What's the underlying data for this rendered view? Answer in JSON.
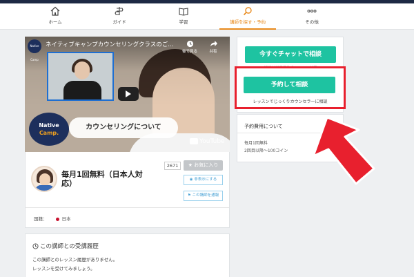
{
  "nav": {
    "items": [
      {
        "label": "ホーム",
        "icon": "home-icon"
      },
      {
        "label": "ガイド",
        "icon": "guide-icon"
      },
      {
        "label": "学習",
        "icon": "book-icon"
      },
      {
        "label": "講師を探す・予約",
        "icon": "search-icon",
        "active": true
      },
      {
        "label": "その他",
        "icon": "more-icon"
      }
    ],
    "accent": "#e8891b"
  },
  "video": {
    "title": "ネイティブキャンプカウンセリングクラスのご...",
    "channel_badge": "Native Camp",
    "watch_later": "後で見る",
    "share": "共有",
    "logo_line1": "Native",
    "logo_line2": "Camp.",
    "overlay_text": "カウンセリングについて",
    "youtube": "YouTube"
  },
  "teacher": {
    "name": "毎月1回無料（日本人対応）",
    "favorite_count": "2671",
    "favorite_label": "★ お気に入り",
    "hide_label": "非表示にする",
    "report_label": "この講師を通報",
    "country_label": "国籍：",
    "country": "日本"
  },
  "history": {
    "title": "この講師との受講履歴",
    "line1": "この講師とのレッスン履歴がありません。",
    "line2": "レッスンを受けてみましょう。"
  },
  "side": {
    "chat_button": "今すぐチャットで相談",
    "chat_note": "相談は当日予約のレッスン対応",
    "book_button": "予約して相談",
    "book_note": "レッスンでじっくりカウンセラーに相談",
    "fee_title": "予約費用について",
    "fee_line1": "毎月1回無料",
    "fee_line2": "2回目以降〜100コイン"
  },
  "colors": {
    "button": "#1ec3a1",
    "highlight": "#e8202e",
    "header_bar": "#1d2a44"
  }
}
